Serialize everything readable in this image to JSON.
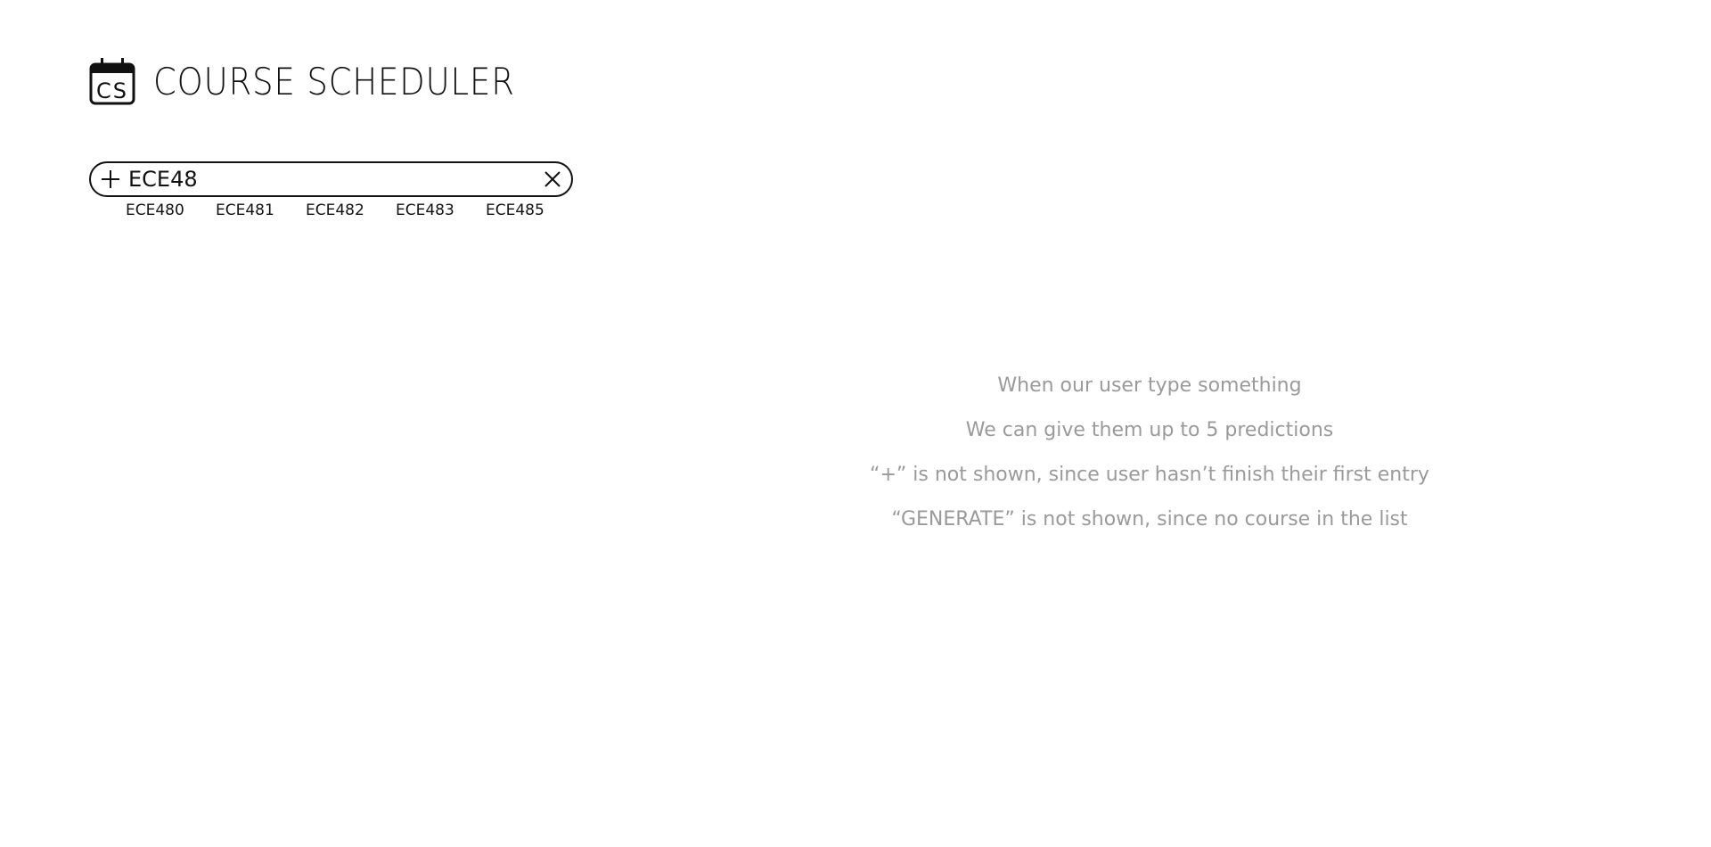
{
  "header": {
    "logo_text": "CS",
    "title": "COURSE SCHEDULER"
  },
  "search": {
    "value": "ECE48",
    "add_icon": "plus-icon",
    "clear_icon": "close-icon"
  },
  "suggestions": [
    "ECE480",
    "ECE481",
    "ECE482",
    "ECE483",
    "ECE485"
  ],
  "notes": [
    "When our user type something",
    "We can give them up to 5 predictions",
    "“+” is not shown, since user hasn’t finish their first entry",
    "“GENERATE” is not shown, since no course in the list"
  ]
}
